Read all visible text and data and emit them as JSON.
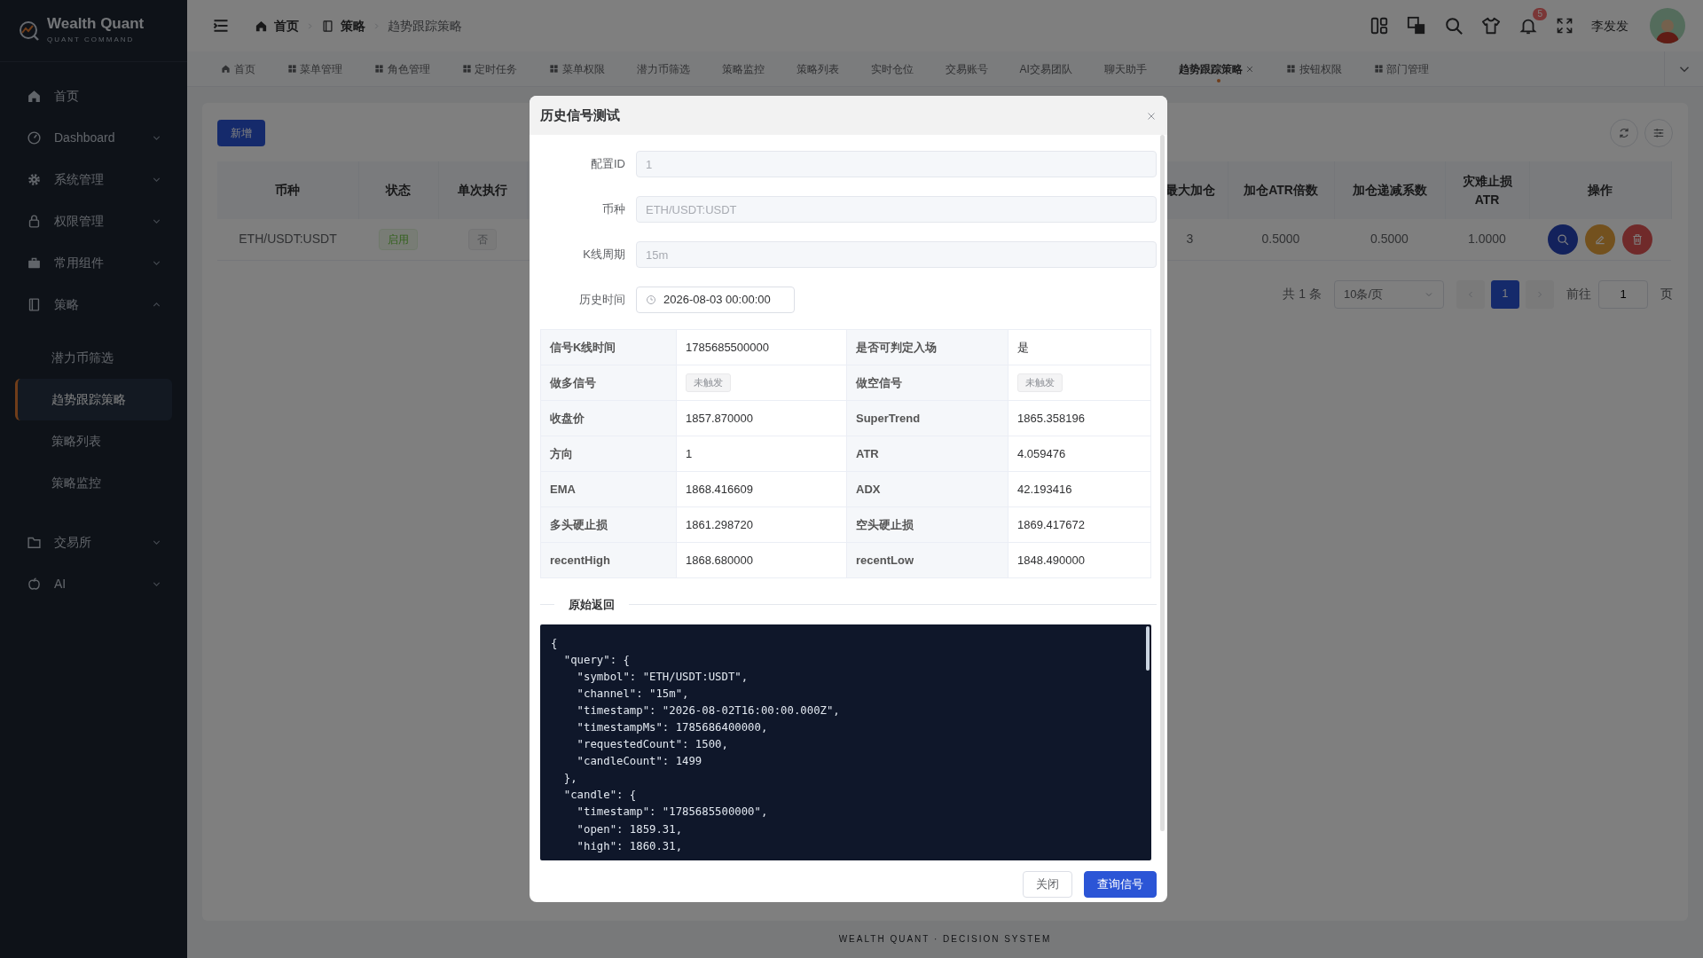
{
  "brand": {
    "name": "Wealth Quant",
    "tagline": "QUANT COMMAND"
  },
  "sidebar": {
    "items": [
      {
        "label": "首页",
        "selected": false
      },
      {
        "label": "Dashboard",
        "selected": false,
        "expanded": false
      },
      {
        "label": "系统管理",
        "selected": false,
        "expanded": false
      },
      {
        "label": "权限管理",
        "selected": false,
        "expanded": false
      },
      {
        "label": "常用组件",
        "selected": false,
        "expanded": false
      },
      {
        "label": "策略",
        "selected": false,
        "expanded": true,
        "children": [
          {
            "label": "潜力币筛选",
            "selected": false
          },
          {
            "label": "趋势跟踪策略",
            "selected": true
          },
          {
            "label": "策略列表",
            "selected": false
          },
          {
            "label": "策略监控",
            "selected": false
          }
        ]
      },
      {
        "label": "交易所",
        "selected": false,
        "expanded": false
      },
      {
        "label": "AI",
        "selected": false,
        "expanded": false
      }
    ]
  },
  "header": {
    "breadcrumb": [
      "首页",
      "策略",
      "趋势跟踪策略"
    ],
    "notification_count": "5",
    "user_name": "李发发"
  },
  "tabs": [
    {
      "label": "首页",
      "selected": false
    },
    {
      "label": "菜单管理",
      "selected": false
    },
    {
      "label": "角色管理",
      "selected": false
    },
    {
      "label": "定时任务",
      "selected": false
    },
    {
      "label": "菜单权限",
      "selected": false
    },
    {
      "label": "潜力币筛选",
      "selected": false
    },
    {
      "label": "策略监控",
      "selected": false
    },
    {
      "label": "策略列表",
      "selected": false
    },
    {
      "label": "实时仓位",
      "selected": false
    },
    {
      "label": "交易账号",
      "selected": false
    },
    {
      "label": "AI交易团队",
      "selected": false
    },
    {
      "label": "聊天助手",
      "selected": false
    },
    {
      "label": "趋势跟踪策略",
      "selected": true
    },
    {
      "label": "按钮权限",
      "selected": false
    },
    {
      "label": "部门管理",
      "selected": false
    }
  ],
  "toolbar": {
    "add_button": "新增"
  },
  "table": {
    "left_columns": [
      "币种",
      "状态",
      "单次执行"
    ],
    "right_columns": [
      "最大加仓",
      "加仓ATR倍数",
      "加仓递减系数",
      "灾难止损ATR",
      "操作"
    ],
    "rows": [
      {
        "symbol": "ETH/USDT:USDT",
        "status": "启用",
        "single_run": "否",
        "max_add": "3",
        "add_atr": "0.5000",
        "decay": "0.5000",
        "stop_atr": "1.0000"
      }
    ]
  },
  "pagination": {
    "total": "共 1 条",
    "page_size": "10条/页",
    "pages": [
      {
        "label": "1",
        "selected": true
      }
    ],
    "goto_label": "前往",
    "goto_value": "1",
    "goto_suffix": "页"
  },
  "footer": "WEALTH QUANT · DECISION SYSTEM",
  "dialog": {
    "title": "历史信号测试",
    "fields": [
      {
        "label": "配置ID",
        "value": "1",
        "kind": "text",
        "disabled": true
      },
      {
        "label": "币种",
        "value": "ETH/USDT:USDT",
        "kind": "text",
        "disabled": true
      },
      {
        "label": "K线周期",
        "value": "15m",
        "kind": "text",
        "disabled": true
      },
      {
        "label": "历史时间",
        "value": "2026-08-03 00:00:00",
        "kind": "datetime",
        "disabled": false
      }
    ],
    "details": [
      [
        {
          "label": "信号K线时间",
          "value": "1785685500000",
          "kind": "text"
        },
        {
          "label": "是否可判定入场",
          "value": "是",
          "kind": "text"
        }
      ],
      [
        {
          "label": "做多信号",
          "value": "未触发",
          "kind": "tag"
        },
        {
          "label": "做空信号",
          "value": "未触发",
          "kind": "tag"
        }
      ],
      [
        {
          "label": "收盘价",
          "value": "1857.870000",
          "kind": "text"
        },
        {
          "label": "SuperTrend",
          "value": "1865.358196",
          "kind": "text"
        }
      ],
      [
        {
          "label": "方向",
          "value": "1",
          "kind": "text"
        },
        {
          "label": "ATR",
          "value": "4.059476",
          "kind": "text"
        }
      ],
      [
        {
          "label": "EMA",
          "value": "1868.416609",
          "kind": "text"
        },
        {
          "label": "ADX",
          "value": "42.193416",
          "kind": "text"
        }
      ],
      [
        {
          "label": "多头硬止损",
          "value": "1861.298720",
          "kind": "text"
        },
        {
          "label": "空头硬止损",
          "value": "1869.417672",
          "kind": "text"
        }
      ],
      [
        {
          "label": "recentHigh",
          "value": "1868.680000",
          "kind": "text"
        },
        {
          "label": "recentLow",
          "value": "1848.490000",
          "kind": "text"
        }
      ]
    ],
    "raw_title": "原始返回",
    "raw_lines": [
      "{",
      "  \"query\": {",
      "    \"symbol\": \"ETH/USDT:USDT\",",
      "    \"channel\": \"15m\",",
      "    \"timestamp\": \"2026-08-02T16:00:00.000Z\",",
      "    \"timestampMs\": 1785686400000,",
      "    \"requestedCount\": 1500,",
      "    \"candleCount\": 1499",
      "  },",
      "  \"candle\": {",
      "    \"timestamp\": \"1785685500000\",",
      "    \"open\": 1859.31,",
      "    \"high\": 1860.31,"
    ],
    "buttons": [
      {
        "label": "关闭",
        "kind": "secondary"
      },
      {
        "label": "查询信号",
        "kind": "primary"
      }
    ]
  }
}
